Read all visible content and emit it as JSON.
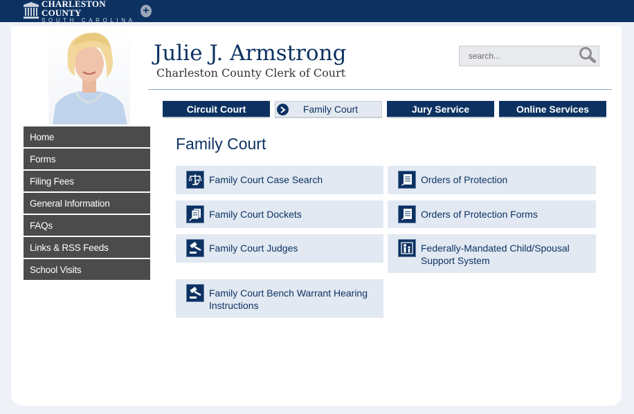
{
  "header": {
    "logo_line1": "CHARLESTON COUNTY",
    "logo_line2": "SOUTH CAROLINA",
    "logo_plus": "+"
  },
  "site": {
    "name": "Julie J. Armstrong",
    "subtitle": "Charleston County Clerk of Court"
  },
  "search": {
    "placeholder": "search..."
  },
  "tabs": [
    {
      "label": "Circuit Court"
    },
    {
      "label": "Family Court"
    },
    {
      "label": "Jury Service"
    },
    {
      "label": "Online Services"
    }
  ],
  "sidenav": {
    "items": [
      {
        "label": "Home"
      },
      {
        "label": "Forms"
      },
      {
        "label": "Filing Fees"
      },
      {
        "label": "General Information"
      },
      {
        "label": "FAQs"
      },
      {
        "label": "Links & RSS Feeds"
      },
      {
        "label": "School Visits"
      }
    ]
  },
  "main": {
    "title": "Family Court",
    "cards": [
      {
        "label": "Family Court Case Search",
        "icon": "scales-icon"
      },
      {
        "label": "Orders of Protection",
        "icon": "document-icon"
      },
      {
        "label": "Family Court Dockets",
        "icon": "documents-icon"
      },
      {
        "label": "Orders of Protection Forms",
        "icon": "document-icon"
      },
      {
        "label": "Family Court Judges",
        "icon": "gavel-icon"
      },
      {
        "label": "Federally-Mandated Child/Spousal Support System",
        "icon": "family-icon"
      },
      {
        "label": "Family Court Bench Warrant Hearing Instructions",
        "icon": "gavel-icon"
      }
    ]
  },
  "colors": {
    "navy": "#0d3262",
    "nav_gray": "#4b4b4b",
    "card_bg": "#e2e9f2"
  }
}
